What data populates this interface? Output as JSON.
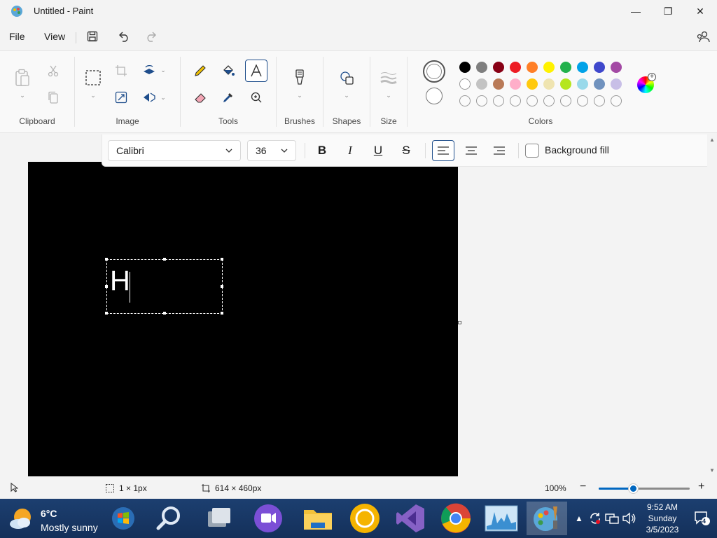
{
  "window": {
    "title": "Untitled - Paint",
    "minimize_glyph": "—",
    "maximize_glyph": "❐",
    "close_glyph": "✕"
  },
  "menu": {
    "file": "File",
    "view": "View"
  },
  "ribbon": {
    "groups": {
      "clipboard": "Clipboard",
      "image": "Image",
      "tools": "Tools",
      "brushes": "Brushes",
      "shapes": "Shapes",
      "size": "Size",
      "colors": "Colors"
    },
    "active_tool": "text-tool",
    "colors": {
      "primary": "#ffffff",
      "secondary": "#ffffff",
      "palette_row1": [
        "#000000",
        "#7f7f7f",
        "#880015",
        "#ed1c24",
        "#ff7f27",
        "#fff200",
        "#22b14c",
        "#00a2e8",
        "#3f48cc",
        "#a349a4"
      ],
      "palette_row2": [
        "#ffffff",
        "#c3c3c3",
        "#b97a57",
        "#ffaec9",
        "#ffc90e",
        "#efe4b0",
        "#b5e61d",
        "#99d9ea",
        "#7092be",
        "#c8bfe7"
      ],
      "palette_row3_count": 10
    }
  },
  "text_toolbar": {
    "font_family": "Calibri",
    "font_size": "36",
    "bold": "B",
    "italic": "I",
    "underline": "U",
    "strikethrough": "S",
    "alignment": "left",
    "background_fill_label": "Background fill",
    "background_fill_checked": false
  },
  "canvas": {
    "background": "#000000",
    "typed_text": "H"
  },
  "status": {
    "selection_size": "1 × 1px",
    "canvas_size": "614 × 460px",
    "zoom": "100%",
    "zoom_out": "−",
    "zoom_in": "+",
    "zoom_level_fraction": 0.38
  },
  "taskbar": {
    "weather_temp": "6°C",
    "weather_desc": "Mostly sunny",
    "apps": [
      "start",
      "search",
      "task-view",
      "teams",
      "file-explorer",
      "chrome-canary",
      "visual-studio",
      "chrome",
      "performance-monitor",
      "paint"
    ],
    "active_app": "paint",
    "clock_time": "9:52 AM",
    "clock_day": "Sunday",
    "clock_date": "3/5/2023",
    "notification_count": "4"
  }
}
